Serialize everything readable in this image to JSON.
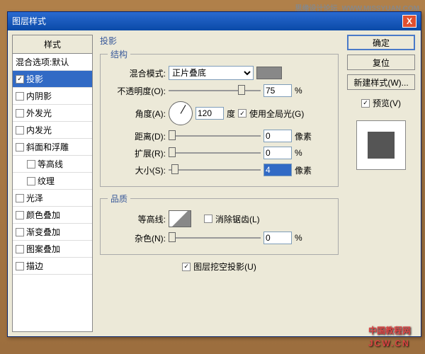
{
  "watermark_top": "思缘设计论坛",
  "watermark_top_url": "WWW.MISSYUAN.COM",
  "watermark_bottom_a": "中国教程",
  "watermark_bottom_b": "网",
  "watermark_bottom_c": "JCW",
  "watermark_bottom_d": "CN",
  "titlebar": {
    "title": "图层样式",
    "close": "X"
  },
  "left": {
    "header": "样式",
    "items": [
      {
        "label": "混合选项:默认",
        "nocheck": true
      },
      {
        "label": "投影",
        "checked": true,
        "selected": true
      },
      {
        "label": "内阴影"
      },
      {
        "label": "外发光"
      },
      {
        "label": "内发光"
      },
      {
        "label": "斜面和浮雕"
      },
      {
        "label": "等高线",
        "indent": true
      },
      {
        "label": "纹理",
        "indent": true
      },
      {
        "label": "光泽"
      },
      {
        "label": "颜色叠加"
      },
      {
        "label": "渐变叠加"
      },
      {
        "label": "图案叠加"
      },
      {
        "label": "描边"
      }
    ]
  },
  "middle": {
    "header": "投影",
    "structure": {
      "legend": "结构",
      "blend_label": "混合模式:",
      "blend_value": "正片叠底",
      "opacity_label": "不透明度(O):",
      "opacity_value": "75",
      "opacity_unit": "%",
      "angle_label": "角度(A):",
      "angle_value": "120",
      "angle_unit": "度",
      "global_light": "使用全局光(G)",
      "distance_label": "距离(D):",
      "distance_value": "0",
      "distance_unit": "像素",
      "spread_label": "扩展(R):",
      "spread_value": "0",
      "spread_unit": "%",
      "size_label": "大小(S):",
      "size_value": "4",
      "size_unit": "像素"
    },
    "quality": {
      "legend": "品质",
      "contour_label": "等高线:",
      "antialias": "消除锯齿(L)",
      "noise_label": "杂色(N):",
      "noise_value": "0",
      "noise_unit": "%"
    },
    "knockout": "图层挖空投影(U)"
  },
  "right": {
    "ok": "确定",
    "cancel": "复位",
    "newstyle": "新建样式(W)...",
    "preview": "预览(V)"
  }
}
